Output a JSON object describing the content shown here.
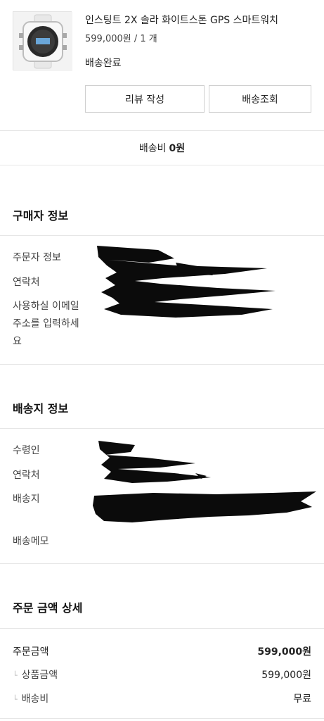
{
  "product": {
    "name": "인스팅트 2X 솔라 화이트스톤 GPS 스마트워치",
    "price_qty": "599,000원 / 1 개",
    "status": "배송완료",
    "review_button": "리뷰 작성",
    "track_button": "배송조회"
  },
  "shipping_fee": {
    "label": "배송비",
    "value": "0원"
  },
  "buyer_info": {
    "title": "구매자 정보",
    "orderer_label": "주문자 정보",
    "contact_label": "연락처",
    "email_label_1": "사용하실 이메일",
    "email_label_2": "주소를 입력하세",
    "email_label_3": "요"
  },
  "delivery_info": {
    "title": "배송지 정보",
    "recipient_label": "수령인",
    "contact_label": "연락처",
    "address_label": "배송지",
    "memo_label": "배송메모"
  },
  "order_amount": {
    "title": "주문 금액 상세",
    "order_total_label": "주문금액",
    "order_total_value": "599,000원",
    "product_amount_label": "상품금액",
    "product_amount_value": "599,000원",
    "shipping_label": "배송비",
    "shipping_value": "무료"
  }
}
